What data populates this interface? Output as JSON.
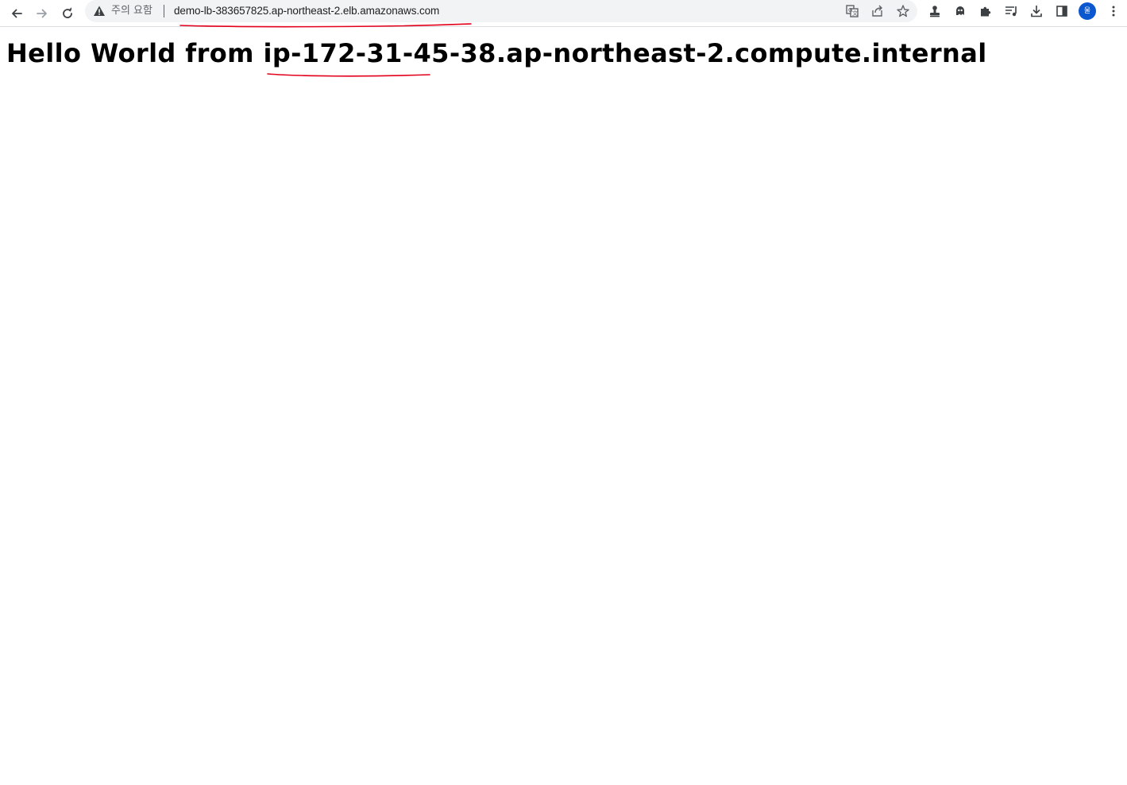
{
  "browser": {
    "security_warning": "주의 요함",
    "url": "demo-lb-383657825.ap-northeast-2.elb.amazonaws.com",
    "profile_initial": "울",
    "nav_icons": [
      "back-arrow-icon",
      "forward-arrow-icon",
      "reload-icon"
    ],
    "omnibox_icons": [
      "translate-icon",
      "share-icon",
      "bookmark-star-icon"
    ],
    "extension_icons": [
      "extension-stamp-icon",
      "extension-ghost-icon",
      "puzzle-icon",
      "reading-list-icon",
      "download-icon",
      "side-panel-icon"
    ],
    "profile_color": "#0b57d0",
    "annotation_color": "#e3001b"
  },
  "page": {
    "heading": "Hello World from ip-172-31-45-38.ap-northeast-2.compute.internal"
  }
}
